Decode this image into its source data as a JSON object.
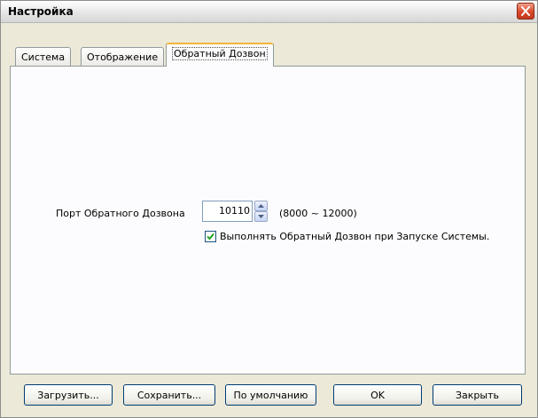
{
  "window": {
    "title": "Настройка"
  },
  "tabs": [
    {
      "label": "Система"
    },
    {
      "label": "Отображение"
    },
    {
      "label": "Обратный Дозвон",
      "active": true
    }
  ],
  "callback": {
    "port_label": "Порт Обратного Дозвона",
    "port_value": "10110",
    "port_range": "(8000 ~ 12000)",
    "autostart_label": "Выполнять Обратный Дозвон при Запуске Системы.",
    "autostart_checked": true
  },
  "buttons": {
    "load": "Загрузить...",
    "save": "Сохранить...",
    "default": "По умолчанию",
    "ok": "OK",
    "close": "Закрыть"
  },
  "icons": {
    "close": "close-icon",
    "spin_up": "spin-up-icon",
    "spin_down": "spin-down-icon",
    "check": "checkmark-icon"
  },
  "colors": {
    "active_tab_accent": "#f4b53a",
    "close_button": "#d8482a",
    "checkbox_check": "#21a121"
  }
}
